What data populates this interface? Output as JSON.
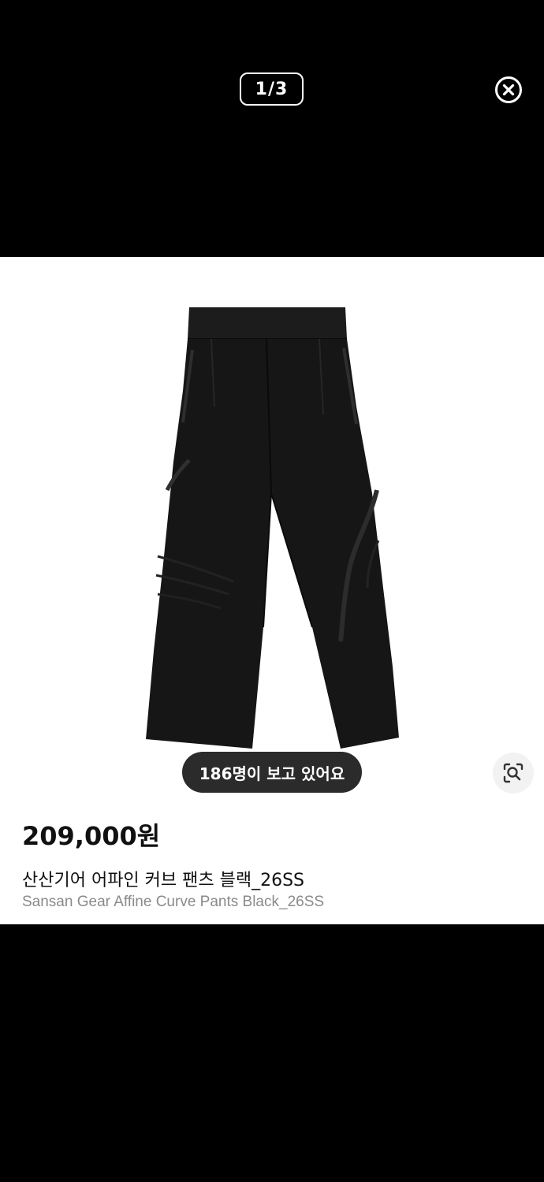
{
  "viewer": {
    "image_counter": "1/3",
    "close_icon": "close-circle-icon"
  },
  "product": {
    "image_alt": "black wide curve pants",
    "viewers_badge": "186명이 보고 있어요",
    "lens_icon": "image-search-icon",
    "price": "209,000원",
    "name_ko": "산산기어 어파인 커브 팬츠 블랙_26SS",
    "name_en": "Sansan Gear Affine Curve Pants Black_26SS"
  },
  "colors": {
    "background": "#000000",
    "sheet": "#ffffff",
    "badge": "#2b2b2b",
    "pants": "#161616"
  }
}
